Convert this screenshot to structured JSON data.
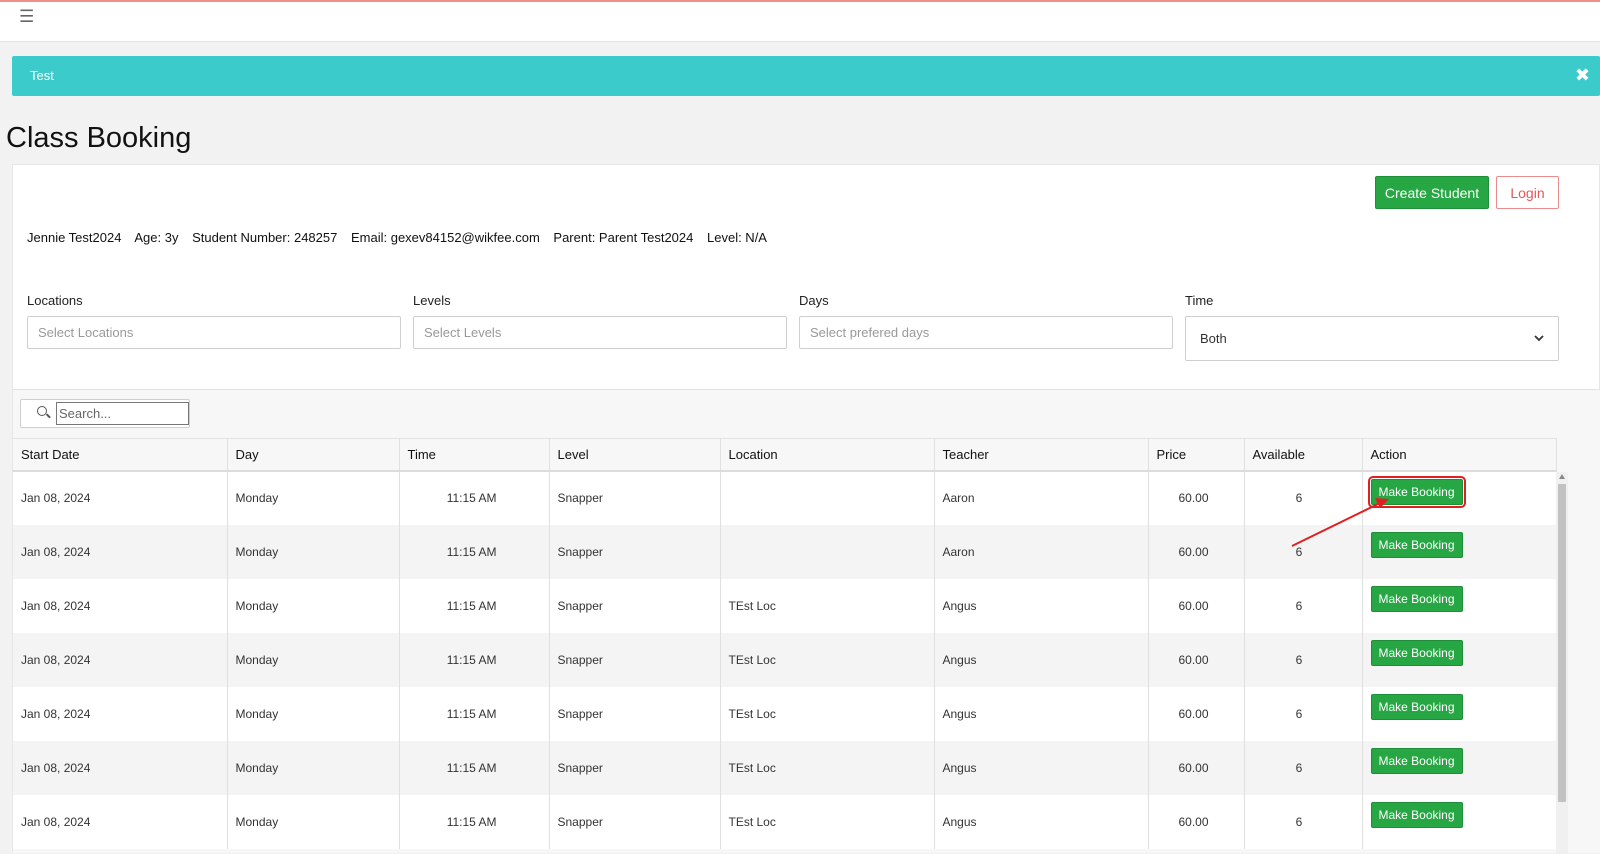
{
  "banner": {
    "text": "Test",
    "close_symbol": "✖"
  },
  "page": {
    "title": "Class Booking"
  },
  "buttons": {
    "create_student": "Create Student",
    "login": "Login"
  },
  "student": [
    "Jennie Test2024",
    "Age: 3y",
    "Student Number: 248257",
    "Email: gexev84152@wikfee.com",
    "Parent: Parent Test2024",
    "Level: N/A"
  ],
  "filters": {
    "locations": {
      "label": "Locations",
      "placeholder": "Select Locations"
    },
    "levels": {
      "label": "Levels",
      "placeholder": "Select Levels"
    },
    "days": {
      "label": "Days",
      "placeholder": "Select prefered days"
    },
    "time": {
      "label": "Time",
      "value": "Both"
    }
  },
  "search": {
    "placeholder": "Search..."
  },
  "table": {
    "headers": [
      "Start Date",
      "Day",
      "Time",
      "Level",
      "Location",
      "Teacher",
      "Price",
      "Available",
      "Action"
    ],
    "action_label": "Make Booking",
    "rows": [
      {
        "start_date": "Jan 08, 2024",
        "day": "Monday",
        "time": "11:15 AM",
        "level": "Snapper",
        "location": "",
        "teacher": "Aaron",
        "price": "60.00",
        "available": "6"
      },
      {
        "start_date": "Jan 08, 2024",
        "day": "Monday",
        "time": "11:15 AM",
        "level": "Snapper",
        "location": "",
        "teacher": "Aaron",
        "price": "60.00",
        "available": "6"
      },
      {
        "start_date": "Jan 08, 2024",
        "day": "Monday",
        "time": "11:15 AM",
        "level": "Snapper",
        "location": "TEst Loc",
        "teacher": "Angus",
        "price": "60.00",
        "available": "6"
      },
      {
        "start_date": "Jan 08, 2024",
        "day": "Monday",
        "time": "11:15 AM",
        "level": "Snapper",
        "location": "TEst Loc",
        "teacher": "Angus",
        "price": "60.00",
        "available": "6"
      },
      {
        "start_date": "Jan 08, 2024",
        "day": "Monday",
        "time": "11:15 AM",
        "level": "Snapper",
        "location": "TEst Loc",
        "teacher": "Angus",
        "price": "60.00",
        "available": "6"
      },
      {
        "start_date": "Jan 08, 2024",
        "day": "Monday",
        "time": "11:15 AM",
        "level": "Snapper",
        "location": "TEst Loc",
        "teacher": "Angus",
        "price": "60.00",
        "available": "6"
      },
      {
        "start_date": "Jan 08, 2024",
        "day": "Monday",
        "time": "11:15 AM",
        "level": "Snapper",
        "location": "TEst Loc",
        "teacher": "Angus",
        "price": "60.00",
        "available": "6"
      }
    ]
  },
  "colors": {
    "banner": "#3ccbcb",
    "success": "#27a744",
    "danger": "#e25757",
    "annotation": "#e02020"
  },
  "icons": {
    "menu": "hamburger-menu-icon",
    "close": "close-icon",
    "search": "search-icon",
    "select": "chevron-down-icon"
  }
}
